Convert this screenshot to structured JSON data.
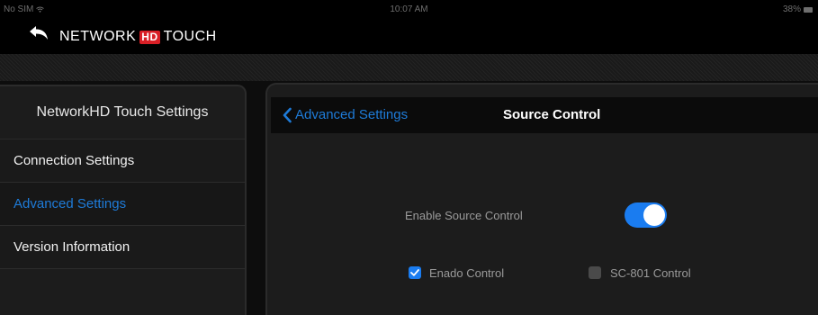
{
  "status_bar": {
    "carrier": "No SIM",
    "wifi_icon": "wifi-icon",
    "time": "10:07 AM",
    "battery": "38%"
  },
  "header": {
    "back_icon": "back-arrow-icon",
    "logo_part1": "NETWORK",
    "logo_hd": "HD",
    "logo_part2": "TOUCH"
  },
  "sidebar": {
    "title": "NetworkHD Touch Settings",
    "items": [
      {
        "label": "Connection Settings",
        "selected": false
      },
      {
        "label": "Advanced Settings",
        "selected": true
      },
      {
        "label": "Version Information",
        "selected": false
      }
    ]
  },
  "detail": {
    "back_label": "Advanced Settings",
    "title": "Source Control",
    "enable_label": "Enable Source Control",
    "enable_on": true,
    "options": [
      {
        "label": "Enado Control",
        "checked": true
      },
      {
        "label": "SC-801 Control",
        "checked": false
      }
    ]
  },
  "colors": {
    "accent": "#1e7bd8",
    "toggle_on": "#1a7cf0",
    "logo_red": "#d91f26"
  }
}
